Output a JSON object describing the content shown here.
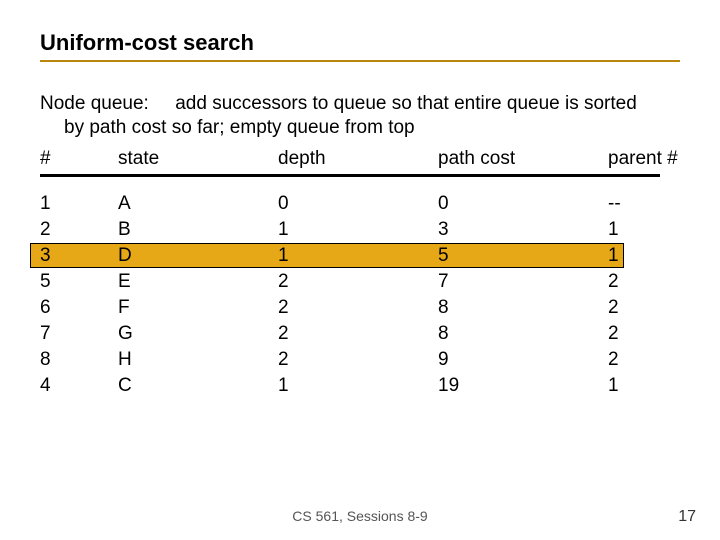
{
  "title": "Uniform-cost search",
  "description": {
    "label": "Node queue:",
    "text_line1": "add successors to queue so that entire queue is sorted",
    "text_line2": "by path cost so far; empty queue from top"
  },
  "headers": {
    "num": "#",
    "state": "state",
    "depth": "depth",
    "path_cost": "path cost",
    "parent": "parent #"
  },
  "rows": [
    {
      "num": "1",
      "state": "A",
      "depth": "0",
      "path_cost": "0",
      "parent": "--",
      "highlight": false
    },
    {
      "num": "2",
      "state": "B",
      "depth": "1",
      "path_cost": "3",
      "parent": "1",
      "highlight": false
    },
    {
      "num": "3",
      "state": "D",
      "depth": "1",
      "path_cost": "5",
      "parent": "1",
      "highlight": true
    },
    {
      "num": "5",
      "state": "E",
      "depth": "2",
      "path_cost": "7",
      "parent": "2",
      "highlight": false
    },
    {
      "num": "6",
      "state": "F",
      "depth": "2",
      "path_cost": "8",
      "parent": "2",
      "highlight": false
    },
    {
      "num": "7",
      "state": "G",
      "depth": "2",
      "path_cost": "8",
      "parent": "2",
      "highlight": false
    },
    {
      "num": "8",
      "state": "H",
      "depth": "2",
      "path_cost": "9",
      "parent": "2",
      "highlight": false
    },
    {
      "num": "4",
      "state": "C",
      "depth": "1",
      "path_cost": "19",
      "parent": "1",
      "highlight": false
    }
  ],
  "footer": "CS 561, Sessions 8-9",
  "page_number": "17",
  "colors": {
    "accent_line": "#b8860b",
    "highlight_fill": "#e6a817"
  }
}
